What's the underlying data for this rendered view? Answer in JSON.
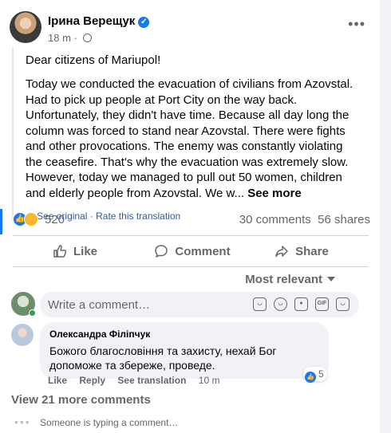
{
  "post": {
    "author": "Ірина Верещук",
    "time": "18 m",
    "greeting": "Dear citizens of Mariupol!",
    "body": "Today we conducted the evacuation of civilians from Azovstal. Had to pick up people at Port City on the way back. Unfortunately, they didn't have time. Because all day long the column was forced to stand near Azovstal. There were fights and other provocations. The enemy was constantly violating the ceasefire. That's why the evacuation was extremely slow. However, today we managed to pull out 50 women, children and elderly people from Azovstal. We w...",
    "see_more": "See more",
    "see_original": "See original",
    "rate_translation": "Rate this translation",
    "separator": "·"
  },
  "stats": {
    "reactions": "520",
    "comments": "30 comments",
    "shares": "56 shares"
  },
  "actions": {
    "like": "Like",
    "comment": "Comment",
    "share": "Share"
  },
  "sort": {
    "label": "Most relevant"
  },
  "composer": {
    "placeholder": "Write a comment…"
  },
  "comments": [
    {
      "author": "Олександра Філіпчук",
      "text": "Божого благословіння та захисту, нехай Бог допоможе та збереже, проведе.",
      "reaction_count": "5",
      "like": "Like",
      "reply": "Reply",
      "see_translation": "See translation",
      "time": "10 m"
    }
  ],
  "view_more": "View 21 more comments",
  "typing": "Someone is typing a comment…",
  "colors": {
    "accent": "#1877f2",
    "secondary_text": "#65676b",
    "background": "#f0f2f5"
  },
  "icons": [
    "verified-badge-icon",
    "globe-icon",
    "more-icon",
    "like-reaction-icon",
    "care-reaction-icon",
    "like-icon",
    "comment-icon",
    "share-icon",
    "caret-down-icon",
    "emoji-icon",
    "camera-icon",
    "gif-icon",
    "sticker-icon"
  ]
}
